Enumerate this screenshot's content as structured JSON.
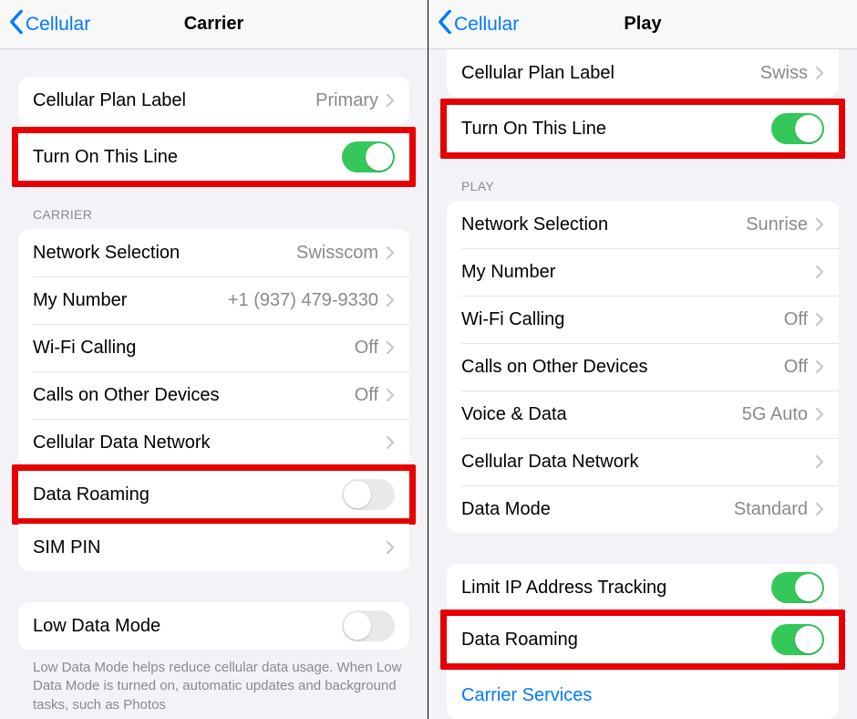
{
  "left": {
    "nav": {
      "back": "Cellular",
      "title": "Carrier"
    },
    "plan": {
      "label": "Cellular Plan Label",
      "value": "Primary"
    },
    "turnOn": {
      "label": "Turn On This Line",
      "on": true
    },
    "carrierHeader": "CARRIER",
    "carrier": {
      "network": {
        "label": "Network Selection",
        "value": "Swisscom"
      },
      "myNumber": {
        "label": "My Number",
        "value": "+1 (937) 479-9330"
      },
      "wifiCalling": {
        "label": "Wi-Fi Calling",
        "value": "Off"
      },
      "callsOther": {
        "label": "Calls on Other Devices",
        "value": "Off"
      },
      "dataNet": {
        "label": "Cellular Data Network"
      },
      "roaming": {
        "label": "Data Roaming",
        "on": false
      },
      "simPin": {
        "label": "SIM PIN"
      }
    },
    "lowData": {
      "label": "Low Data Mode",
      "on": false
    },
    "footer": "Low Data Mode helps reduce cellular data usage. When Low Data Mode is turned on, automatic updates and background tasks, such as Photos"
  },
  "right": {
    "nav": {
      "back": "Cellular",
      "title": "Play"
    },
    "plan": {
      "label": "Cellular Plan Label",
      "value": "Swiss"
    },
    "turnOn": {
      "label": "Turn On This Line",
      "on": true
    },
    "playHeader": "PLAY",
    "play": {
      "network": {
        "label": "Network Selection",
        "value": "Sunrise"
      },
      "myNumber": {
        "label": "My Number"
      },
      "wifiCalling": {
        "label": "Wi-Fi Calling",
        "value": "Off"
      },
      "callsOther": {
        "label": "Calls on Other Devices",
        "value": "Off"
      },
      "voiceData": {
        "label": "Voice & Data",
        "value": "5G Auto"
      },
      "dataNet": {
        "label": "Cellular Data Network"
      },
      "dataMode": {
        "label": "Data Mode",
        "value": "Standard"
      }
    },
    "ipTrack": {
      "label": "Limit IP Address Tracking",
      "on": true
    },
    "roaming": {
      "label": "Data Roaming",
      "on": true
    },
    "carrierServices": "Carrier Services"
  }
}
